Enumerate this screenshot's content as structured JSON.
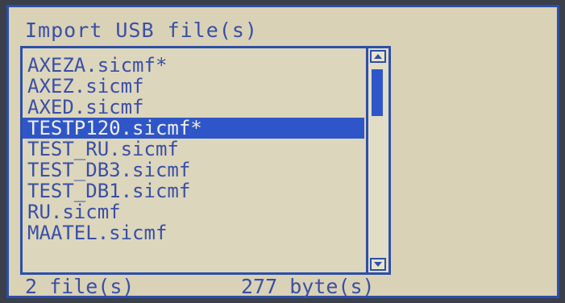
{
  "dialog": {
    "title": "Import USB file(s)"
  },
  "files": [
    {
      "name": "AXEZA.sicmf*",
      "selected": false
    },
    {
      "name": "AXEZ.sicmf",
      "selected": false
    },
    {
      "name": "AXED.sicmf",
      "selected": false
    },
    {
      "name": "TESTP120.sicmf*",
      "selected": true
    },
    {
      "name": "TEST_RU.sicmf",
      "selected": false
    },
    {
      "name": "TEST_DB3.sicmf",
      "selected": false
    },
    {
      "name": "TEST_DB1.sicmf",
      "selected": false
    },
    {
      "name": "RU.sicmf",
      "selected": false
    },
    {
      "name": "MAATEL.sicmf",
      "selected": false
    }
  ],
  "status": {
    "file_count": "2 file(s)",
    "byte_count": "277 byte(s)"
  },
  "icons": {
    "scroll_up": "up-triangle-icon",
    "scroll_down": "down-triangle-icon"
  }
}
